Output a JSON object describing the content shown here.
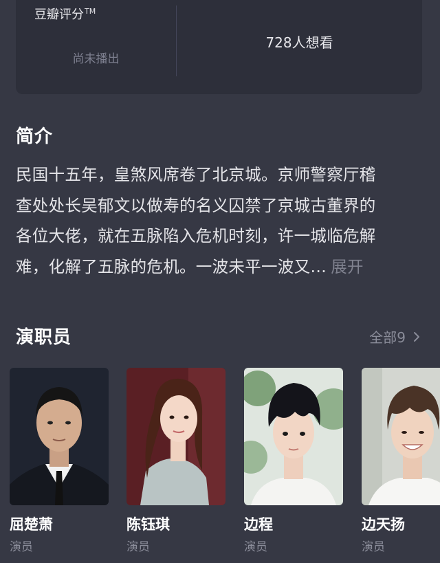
{
  "rating": {
    "brand": "豆瓣评分",
    "trademark": "TM",
    "status": "尚未播出",
    "want_to_watch": "728人想看"
  },
  "intro": {
    "title": "简介",
    "lines": [
      "民国十五年，皇煞风席卷了北京城。京师警察厅稽",
      "查处处长吴郁文以做寿的名义囚禁了京城古董界的",
      "各位大佬，就在五脉陷入危机时刻，许一城临危解",
      "难，化解了五脉的危机。一波未平一波又…"
    ],
    "expand": "展开"
  },
  "cast": {
    "title": "演职员",
    "see_all": "全部9",
    "members": [
      {
        "name": "屈楚萧",
        "role": "演员"
      },
      {
        "name": "陈钰琪",
        "role": "演员"
      },
      {
        "name": "边程",
        "role": "演员"
      },
      {
        "name": "边天扬",
        "role": "演员"
      }
    ]
  },
  "colors": {
    "background": "#363844",
    "card": "#2d2f3a",
    "muted_text": "#8a8c99"
  }
}
